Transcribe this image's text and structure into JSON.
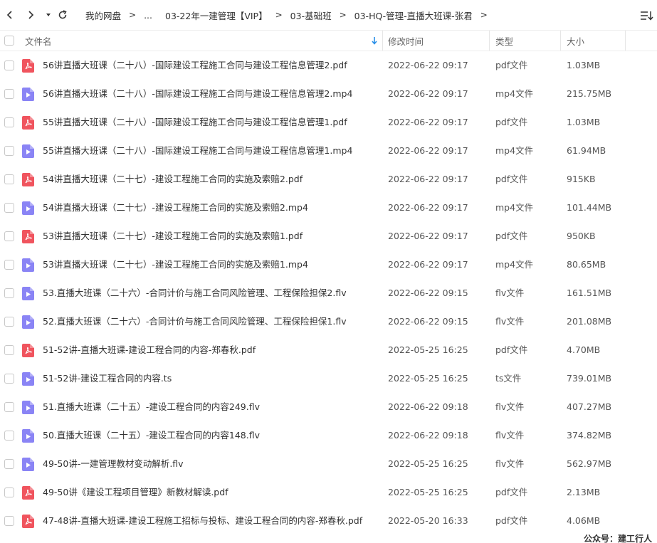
{
  "toolbar": {
    "breadcrumbs": [
      "我的网盘",
      "...",
      "03-22年一建管理【VIP】",
      "03-基础班",
      "03-HQ-管理-直播大班课-张君"
    ],
    "separator": ">"
  },
  "header": {
    "name": "文件名",
    "modified": "修改时间",
    "type": "类型",
    "size": "大小"
  },
  "colors": {
    "pdf": "#f0545e",
    "video": "#8a84f5",
    "sort_arrow": "#2a8fe8"
  },
  "files": [
    {
      "name": "56讲直播大班课（二十八）-国际建设工程施工合同与建设工程信息管理2.pdf",
      "date": "2022-06-22 09:17",
      "type": "pdf文件",
      "size": "1.03MB",
      "icon": "pdf-icon"
    },
    {
      "name": "56讲直播大班课（二十八）-国际建设工程施工合同与建设工程信息管理2.mp4",
      "date": "2022-06-22 09:17",
      "type": "mp4文件",
      "size": "215.75MB",
      "icon": "video-icon"
    },
    {
      "name": "55讲直播大班课（二十八）-国际建设工程施工合同与建设工程信息管理1.pdf",
      "date": "2022-06-22 09:17",
      "type": "pdf文件",
      "size": "1.03MB",
      "icon": "pdf-icon"
    },
    {
      "name": "55讲直播大班课（二十八）-国际建设工程施工合同与建设工程信息管理1.mp4",
      "date": "2022-06-22 09:17",
      "type": "mp4文件",
      "size": "61.94MB",
      "icon": "video-icon"
    },
    {
      "name": "54讲直播大班课（二十七）-建设工程施工合同的实施及索赔2.pdf",
      "date": "2022-06-22 09:17",
      "type": "pdf文件",
      "size": "915KB",
      "icon": "pdf-icon"
    },
    {
      "name": "54讲直播大班课（二十七）-建设工程施工合同的实施及索赔2.mp4",
      "date": "2022-06-22 09:17",
      "type": "mp4文件",
      "size": "101.44MB",
      "icon": "video-icon"
    },
    {
      "name": "53讲直播大班课（二十七）-建设工程施工合同的实施及索赔1.pdf",
      "date": "2022-06-22 09:17",
      "type": "pdf文件",
      "size": "950KB",
      "icon": "pdf-icon"
    },
    {
      "name": "53讲直播大班课（二十七）-建设工程施工合同的实施及索赔1.mp4",
      "date": "2022-06-22 09:17",
      "type": "mp4文件",
      "size": "80.65MB",
      "icon": "video-icon"
    },
    {
      "name": "53.直播大班课（二十六）-合同计价与施工合同风险管理、工程保险担保2.flv",
      "date": "2022-06-22 09:15",
      "type": "flv文件",
      "size": "161.51MB",
      "icon": "video-icon"
    },
    {
      "name": "52.直播大班课（二十六）-合同计价与施工合同风险管理、工程保险担保1.flv",
      "date": "2022-06-22 09:15",
      "type": "flv文件",
      "size": "201.08MB",
      "icon": "video-icon"
    },
    {
      "name": "51-52讲-直播大班课-建设工程合同的内容-郑春秋.pdf",
      "date": "2022-05-25 16:25",
      "type": "pdf文件",
      "size": "4.70MB",
      "icon": "pdf-icon"
    },
    {
      "name": "51-52讲-建设工程合同的内容.ts",
      "date": "2022-05-25 16:25",
      "type": "ts文件",
      "size": "739.01MB",
      "icon": "video-icon"
    },
    {
      "name": "51.直播大班课（二十五）-建设工程合同的内容249.flv",
      "date": "2022-06-22 09:18",
      "type": "flv文件",
      "size": "407.27MB",
      "icon": "video-icon"
    },
    {
      "name": "50.直播大班课（二十五）-建设工程合同的内容148.flv",
      "date": "2022-06-22 09:18",
      "type": "flv文件",
      "size": "374.82MB",
      "icon": "video-icon"
    },
    {
      "name": "49-50讲-一建管理教材变动解析.flv",
      "date": "2022-05-25 16:25",
      "type": "flv文件",
      "size": "562.97MB",
      "icon": "video-icon"
    },
    {
      "name": "49-50讲《建设工程项目管理》新教材解读.pdf",
      "date": "2022-05-25 16:25",
      "type": "pdf文件",
      "size": "2.13MB",
      "icon": "pdf-icon"
    },
    {
      "name": "47-48讲-直播大班课-建设工程施工招标与投标、建设工程合同的内容-郑春秋.pdf",
      "date": "2022-05-20 16:33",
      "type": "pdf文件",
      "size": "4.06MB",
      "icon": "pdf-icon"
    }
  ],
  "watermark": "公众号：建工行人"
}
